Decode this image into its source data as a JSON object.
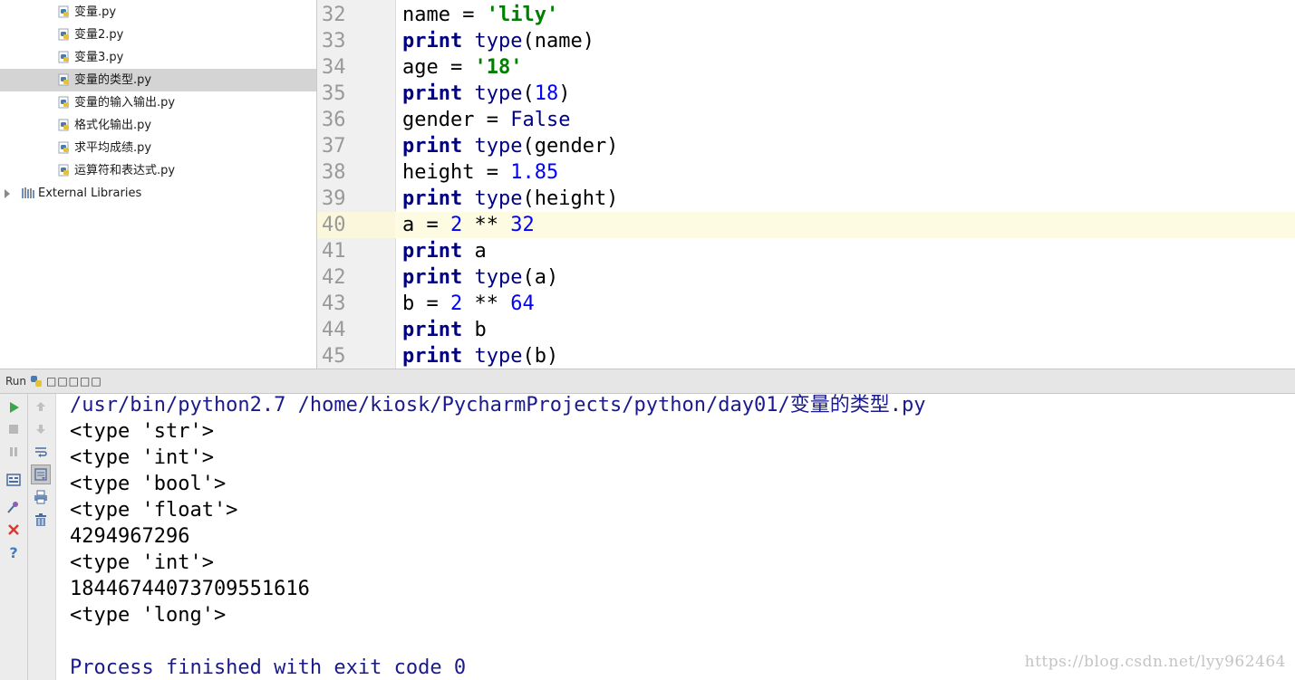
{
  "project_tree": {
    "files": [
      {
        "name": "变量.py",
        "selected": false
      },
      {
        "name": "变量2.py",
        "selected": false
      },
      {
        "name": "变量3.py",
        "selected": false
      },
      {
        "name": "变量的类型.py",
        "selected": true
      },
      {
        "name": "变量的输入输出.py",
        "selected": false
      },
      {
        "name": "格式化输出.py",
        "selected": false
      },
      {
        "name": "求平均成绩.py",
        "selected": false
      },
      {
        "name": "运算符和表达式.py",
        "selected": false
      }
    ],
    "external_libraries": "External Libraries"
  },
  "editor": {
    "current_line": "40",
    "lines": [
      {
        "n": "32",
        "tokens": [
          {
            "t": "name = ",
            "c": ""
          },
          {
            "t": "'lily'",
            "c": "str"
          }
        ]
      },
      {
        "n": "33",
        "tokens": [
          {
            "t": "print",
            "c": "kw"
          },
          {
            "t": " ",
            "c": ""
          },
          {
            "t": "type",
            "c": "bi"
          },
          {
            "t": "(name)",
            "c": ""
          }
        ]
      },
      {
        "n": "34",
        "tokens": [
          {
            "t": "age = ",
            "c": ""
          },
          {
            "t": "'18'",
            "c": "str"
          }
        ]
      },
      {
        "n": "35",
        "tokens": [
          {
            "t": "print",
            "c": "kw"
          },
          {
            "t": " ",
            "c": ""
          },
          {
            "t": "type",
            "c": "bi"
          },
          {
            "t": "(",
            "c": ""
          },
          {
            "t": "18",
            "c": "num"
          },
          {
            "t": ")",
            "c": ""
          }
        ]
      },
      {
        "n": "36",
        "tokens": [
          {
            "t": "gender = ",
            "c": ""
          },
          {
            "t": "False",
            "c": "bi"
          }
        ]
      },
      {
        "n": "37",
        "tokens": [
          {
            "t": "print",
            "c": "kw"
          },
          {
            "t": " ",
            "c": ""
          },
          {
            "t": "type",
            "c": "bi"
          },
          {
            "t": "(gender)",
            "c": ""
          }
        ]
      },
      {
        "n": "38",
        "tokens": [
          {
            "t": "height = ",
            "c": ""
          },
          {
            "t": "1.85",
            "c": "num"
          }
        ]
      },
      {
        "n": "39",
        "tokens": [
          {
            "t": "print",
            "c": "kw"
          },
          {
            "t": " ",
            "c": ""
          },
          {
            "t": "type",
            "c": "bi"
          },
          {
            "t": "(height)",
            "c": ""
          }
        ]
      },
      {
        "n": "40",
        "tokens": [
          {
            "t": "a = ",
            "c": ""
          },
          {
            "t": "2",
            "c": "num"
          },
          {
            "t": " ** ",
            "c": ""
          },
          {
            "t": "32",
            "c": "num"
          }
        ]
      },
      {
        "n": "41",
        "tokens": [
          {
            "t": "print",
            "c": "kw"
          },
          {
            "t": " a",
            "c": ""
          }
        ]
      },
      {
        "n": "42",
        "tokens": [
          {
            "t": "print",
            "c": "kw"
          },
          {
            "t": " ",
            "c": ""
          },
          {
            "t": "type",
            "c": "bi"
          },
          {
            "t": "(a)",
            "c": ""
          }
        ]
      },
      {
        "n": "43",
        "tokens": [
          {
            "t": "b = ",
            "c": ""
          },
          {
            "t": "2",
            "c": "num"
          },
          {
            "t": " ** ",
            "c": ""
          },
          {
            "t": "64",
            "c": "num"
          }
        ]
      },
      {
        "n": "44",
        "tokens": [
          {
            "t": "print",
            "c": "kw"
          },
          {
            "t": " b",
            "c": ""
          }
        ]
      },
      {
        "n": "45",
        "tokens": [
          {
            "t": "print",
            "c": "kw"
          },
          {
            "t": " ",
            "c": ""
          },
          {
            "t": "type",
            "c": "bi"
          },
          {
            "t": "(b)",
            "c": ""
          }
        ]
      }
    ]
  },
  "run_panel": {
    "tab_label": "Run",
    "config_name": "□□□□□",
    "console": [
      {
        "text": "/usr/bin/python2.7 /home/kiosk/PycharmProjects/python/day01/变量的类型.py",
        "kind": "system"
      },
      {
        "text": "<type 'str'>",
        "kind": "out"
      },
      {
        "text": "<type 'int'>",
        "kind": "out"
      },
      {
        "text": "<type 'bool'>",
        "kind": "out"
      },
      {
        "text": "<type 'float'>",
        "kind": "out"
      },
      {
        "text": "4294967296",
        "kind": "out"
      },
      {
        "text": "<type 'int'>",
        "kind": "out"
      },
      {
        "text": "18446744073709551616",
        "kind": "out"
      },
      {
        "text": "<type 'long'>",
        "kind": "out"
      },
      {
        "text": "",
        "kind": "out"
      },
      {
        "text": "Process finished with exit code 0",
        "kind": "system"
      }
    ],
    "left_toolbar_icons": [
      "run-icon",
      "stop-icon",
      "pause-icon",
      "layout-icon",
      "pin-icon",
      "close-icon",
      "help-icon"
    ],
    "right_toolbar_icons": [
      "up-arrow-icon",
      "down-arrow-icon",
      "soft-wrap-icon",
      "scroll-to-end-icon",
      "print-icon",
      "trash-icon"
    ]
  },
  "watermark": "https://blog.csdn.net/lyy962464",
  "colors": {
    "keyword": "#000080",
    "string": "#008000",
    "number": "#0000ff",
    "current_line": "#fefbe3",
    "selection": "#d4d4d4"
  }
}
